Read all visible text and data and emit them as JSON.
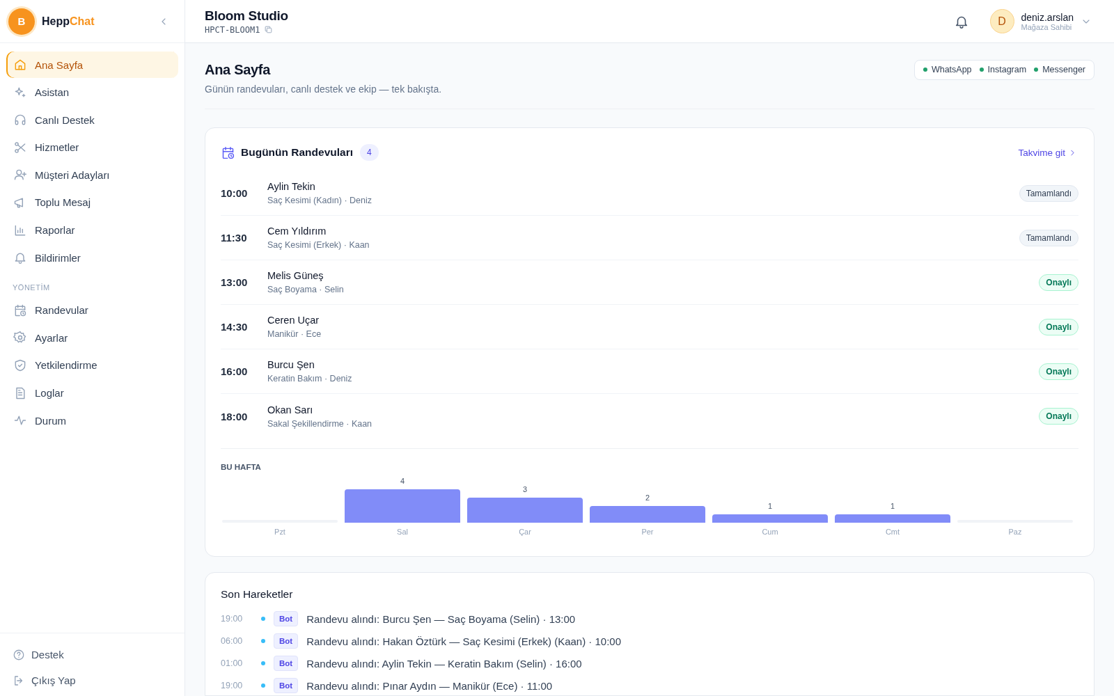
{
  "sidebar": {
    "logo_initial": "B",
    "brand_start": "Hepp",
    "brand_accent": "Chat",
    "items": [
      {
        "label": "Ana Sayfa",
        "selected": true
      },
      {
        "label": "Asistan",
        "selected": false
      },
      {
        "label": "Canlı Destek",
        "selected": false
      },
      {
        "label": "Hizmetler",
        "selected": false
      },
      {
        "label": "Müşteri Adayları",
        "selected": false
      },
      {
        "label": "Toplu Mesaj",
        "selected": false
      },
      {
        "label": "Raporlar",
        "selected": false
      },
      {
        "label": "Bildirimler",
        "selected": false
      }
    ],
    "section_title": "YÖNETİM",
    "admin_items": [
      {
        "label": "Randevular",
        "selected": false
      },
      {
        "label": "Ayarlar",
        "selected": false
      },
      {
        "label": "Yetkilendirme",
        "selected": false
      },
      {
        "label": "Loglar",
        "selected": false
      },
      {
        "label": "Durum",
        "selected": false
      }
    ],
    "footer_items": [
      {
        "label": "Destek"
      },
      {
        "label": "Çıkış Yap"
      }
    ]
  },
  "header": {
    "store_name": "Bloom Studio",
    "store_code": "HPCT-BLOOM1",
    "user_initial": "D",
    "user_name": "deniz.arslan",
    "user_role": "Mağaza Sahibi"
  },
  "page": {
    "title": "Ana Sayfa",
    "subtitle": "Günün randevuları, canlı destek ve ekip — tek bakışta.",
    "channels": [
      {
        "name": "WhatsApp",
        "connected": true
      },
      {
        "name": "Instagram",
        "connected": true
      },
      {
        "name": "Messenger",
        "connected": true
      }
    ]
  },
  "appointments": {
    "title": "Bugünün Randevuları",
    "count": "4",
    "link": "Takvime git",
    "rows": [
      {
        "time": "10:00",
        "name": "Aylin Tekin",
        "detail": "Saç Kesimi (Kadın) · Deniz",
        "status": "Tamamlandı",
        "kind": "completed"
      },
      {
        "time": "11:30",
        "name": "Cem Yıldırım",
        "detail": "Saç Kesimi (Erkek) · Kaan",
        "status": "Tamamlandı",
        "kind": "completed"
      },
      {
        "time": "13:00",
        "name": "Melis Güneş",
        "detail": "Saç Boyama · Selin",
        "status": "Onaylı",
        "kind": "confirmed"
      },
      {
        "time": "14:30",
        "name": "Ceren Uçar",
        "detail": "Manikür · Ece",
        "status": "Onaylı",
        "kind": "confirmed"
      },
      {
        "time": "16:00",
        "name": "Burcu Şen",
        "detail": "Keratin Bakım · Deniz",
        "status": "Onaylı",
        "kind": "confirmed"
      },
      {
        "time": "18:00",
        "name": "Okan Sarı",
        "detail": "Sakal Şekillendirme · Kaan",
        "status": "Onaylı",
        "kind": "confirmed"
      }
    ],
    "week_title": "BU HAFTA",
    "chart_data": {
      "type": "bar",
      "categories": [
        "Pzt",
        "Sal",
        "Çar",
        "Per",
        "Cum",
        "Cmt",
        "Paz"
      ],
      "values": [
        0,
        4,
        3,
        2,
        1,
        1,
        0
      ],
      "value_labels": [
        null,
        "4",
        "3",
        "2",
        "1",
        "1",
        null
      ]
    }
  },
  "activity": {
    "title": "Son Hareketler",
    "items": [
      {
        "time": "19:00",
        "tag": "Bot",
        "text": "Randevu alındı: Burcu Şen — Saç Boyama (Selin) · 13:00"
      },
      {
        "time": "06:00",
        "tag": "Bot",
        "text": "Randevu alındı: Hakan Öztürk — Saç Kesimi (Erkek) (Kaan) · 10:00"
      },
      {
        "time": "01:00",
        "tag": "Bot",
        "text": "Randevu alındı: Aylin Tekin — Keratin Bakım (Selin) · 16:00"
      },
      {
        "time": "19:00",
        "tag": "Bot",
        "text": "Randevu alındı: Pınar Aydın — Manikür (Ece) · 11:00"
      }
    ]
  }
}
